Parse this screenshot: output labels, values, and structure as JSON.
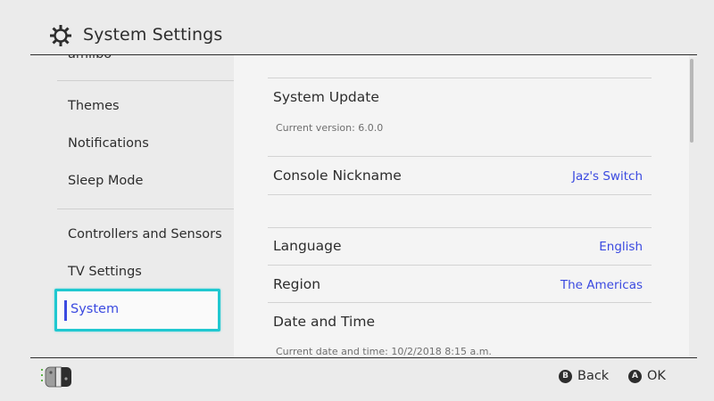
{
  "header": {
    "title": "System Settings",
    "icon": "gear-icon"
  },
  "sidebar": {
    "cut_item": "amiibo",
    "items": [
      {
        "label": "Themes"
      },
      {
        "label": "Notifications"
      },
      {
        "label": "Sleep Mode"
      },
      {
        "label": "Controllers and Sensors"
      },
      {
        "label": "TV Settings"
      },
      {
        "label": "System",
        "selected": true
      }
    ]
  },
  "main": {
    "system_update": {
      "label": "System Update",
      "sub": "Current version: 6.0.0"
    },
    "console_nickname": {
      "label": "Console Nickname",
      "value": "Jaz's Switch"
    },
    "language": {
      "label": "Language",
      "value": "English"
    },
    "region": {
      "label": "Region",
      "value": "The Americas"
    },
    "date_time": {
      "label": "Date and Time",
      "sub": "Current date and time: 10/2/2018 8:15 a.m."
    }
  },
  "footer": {
    "back": {
      "button": "B",
      "label": "Back"
    },
    "ok": {
      "button": "A",
      "label": "OK"
    }
  },
  "colors": {
    "background": "#ebebeb",
    "panel": "#f4f4f4",
    "accent_text": "#3b4ae0",
    "selection_border": "#20c8d0",
    "text": "#2d2d2d"
  }
}
